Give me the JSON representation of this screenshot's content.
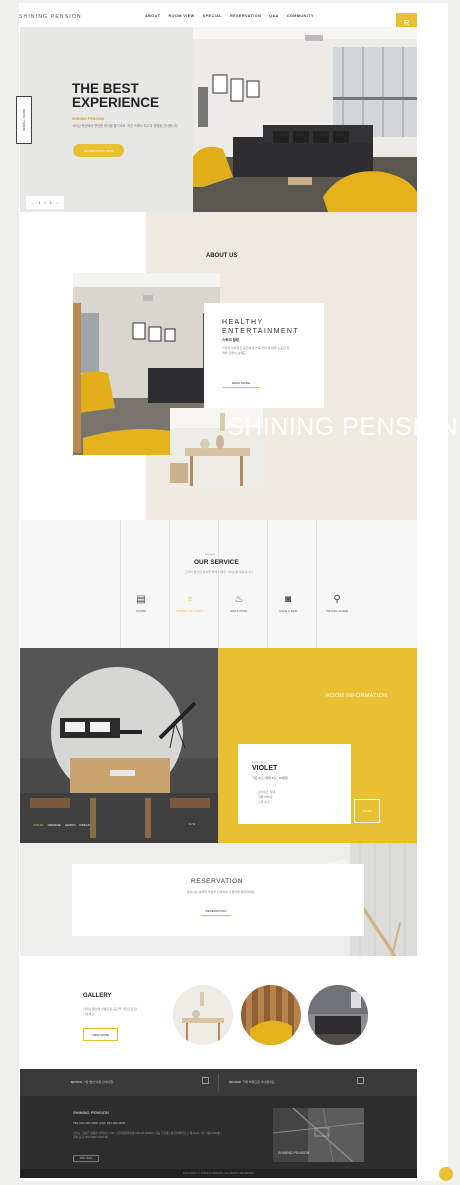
{
  "header": {
    "logo": "SHINING PENSION",
    "nav": [
      "ABOUT",
      "ROOM VIEW",
      "SPECIAL",
      "RESERVATION",
      "Q&A",
      "COMMUNITY"
    ],
    "corner_button": "R"
  },
  "hero": {
    "title": "THE BEST EXPERIENCE",
    "subtitle": "SHINING PENSION",
    "description": "샤이닝 펜션에서 편안한 휴식을 즐기세요. 자연 속에서 최고의 경험을 선사합니다.",
    "button": "RESERVATION NOW",
    "side_tab": "SCROLL DOWN",
    "pager_current": "1",
    "pager_total": "3",
    "pager_prev": "←",
    "pager_next": "→"
  },
  "about": {
    "title": "ABOUT US",
    "card_title": "HEALTHY ENTERTAINMENT",
    "card_sub": "스토리 힐링",
    "card_desc": "자연과 어우러진 공간에서 가족, 연인과 함께 소중한 추억을 만들어 보세요.",
    "card_link": "READ MORE",
    "banner": "SHINING PENSION"
  },
  "service": {
    "small": "service",
    "title": "OUR SERVICE",
    "desc": "고객의 편안한 휴식을 위해 다양한 서비스를 제공합니다.",
    "items": [
      {
        "icon": "▤",
        "label": "ROOM"
      },
      {
        "icon": "♆",
        "label": "BARBECUE PARTY"
      },
      {
        "icon": "♨",
        "label": "SPA & POOL"
      },
      {
        "icon": "◙",
        "label": "CAFE & BAR"
      },
      {
        "icon": "⚲",
        "label": "TRAVEL GUIDE"
      }
    ]
  },
  "room": {
    "heading": "ROOM INFORMATION",
    "small": "Room type",
    "name": "VIOLET",
    "desc": "기준 2인 / 최대 4인 · 30평형",
    "features": [
      "- 퀸사이즈 침대",
      "- 개별 바베큐",
      "- 스파 욕조"
    ],
    "arrow": "→",
    "more": "MORE",
    "tabs": [
      "VIOLET",
      "ORANGE",
      "LEMON",
      "INDIGO"
    ],
    "pager": "1 / 4"
  },
  "reservation": {
    "title": "RESERVATION",
    "desc": "원하시는 날짜와 객실을 선택하여 간편하게 예약하세요.",
    "link": "RESERVATION"
  },
  "gallery": {
    "title": "GALLERY",
    "desc": "샤이닝 펜션의 아름다운 공간을 사진으로 만나보세요.",
    "button": "VIEW MORE"
  },
  "footer": {
    "left_label": "NOTICE",
    "left_text": "7월 펜션 이용 안내사항",
    "right_label": "REVIEW",
    "right_text": "가족 여행으로 다녀왔어요",
    "name": "SHINING PENSION",
    "contact": "TEL 031-000-0000 | FAX 031-000-0001",
    "address": "경기도 가평군 청평면 샤이닝로 123 | 사업자등록번호 000-00-00000 | 대표 홍길동 | 통신판매업신고 제 2024-경기가평-0000호 | 계좌 농협 000-0000-0000-00",
    "button": "MAP VIEW",
    "map_label": "SHINING PENSION",
    "copyright": "COPYRIGHT © SHINING PENSION. ALL RIGHTS RESERVED."
  },
  "colors": {
    "accent": "#e8c032",
    "dark": "#2d2d2d",
    "beige": "#efeae0"
  }
}
